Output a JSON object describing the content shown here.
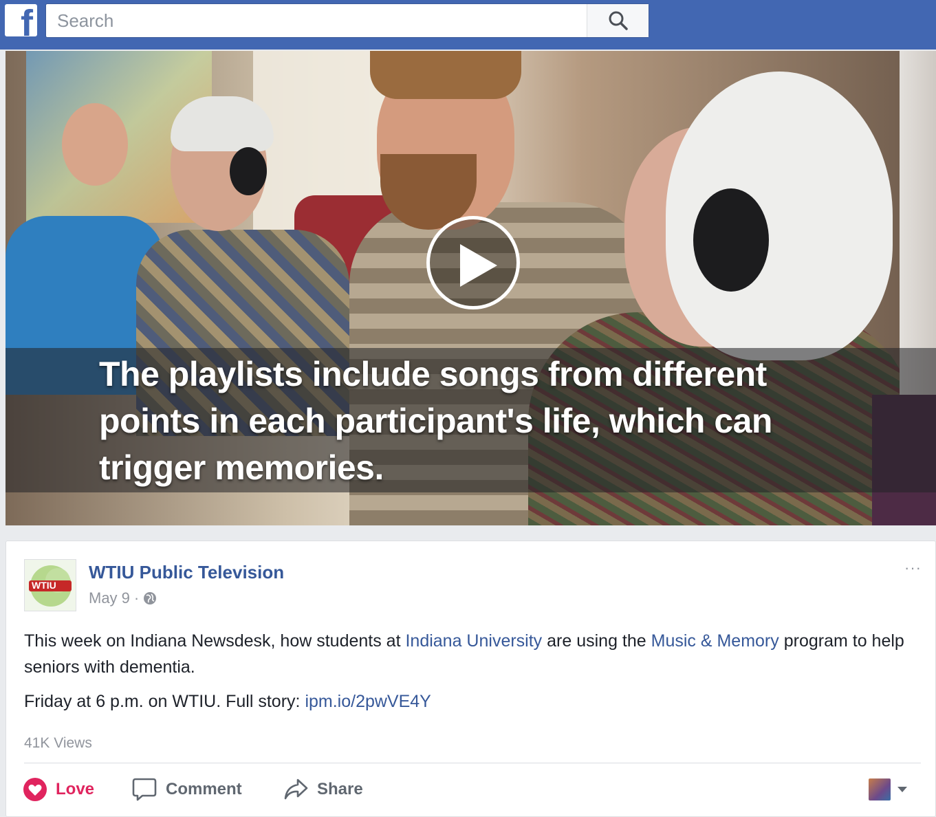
{
  "header": {
    "logo": "f",
    "search": {
      "placeholder": "Search",
      "value": ""
    },
    "icons": {
      "search": "search-icon"
    },
    "colors": {
      "bar": "#4267b2"
    }
  },
  "video": {
    "caption": "The playlists include songs from different points in each participant's life, which can trigger memories.",
    "icons": {
      "play": "play-icon"
    }
  },
  "post": {
    "page_name": "WTIU Public Television",
    "avatar_text": "WTIU",
    "date": "May 9",
    "meta_separator": "·",
    "text": {
      "p1_a": "This week on Indiana Newsdesk, how students at ",
      "link1": "Indiana University",
      "p1_b": " are using the ",
      "link2": "Music & Memory",
      "p1_c": " program to help seniors with dementia.",
      "p2_a": "Friday at 6 p.m. on WTIU. Full story: ",
      "link3": "ipm.io/2pwVE4Y"
    },
    "views": "41K Views",
    "more": "···",
    "actions": {
      "love": "Love",
      "comment": "Comment",
      "share": "Share"
    },
    "colors": {
      "link": "#365899",
      "love": "#e0245e"
    }
  }
}
